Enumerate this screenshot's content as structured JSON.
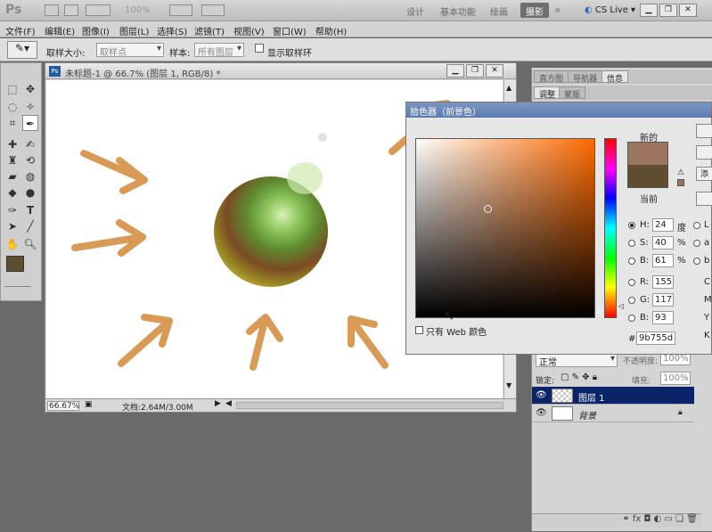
{
  "appbar": {
    "logo": "Ps",
    "zoom": "100%",
    "workspaces": [
      "设计",
      "基本功能",
      "绘画",
      "摄影"
    ],
    "active_workspace": "摄影",
    "more": "»",
    "cslive": "CS Live"
  },
  "menu": [
    "文件(F)",
    "编辑(E)",
    "图像(I)",
    "图层(L)",
    "选择(S)",
    "滤镜(T)",
    "视图(V)",
    "窗口(W)",
    "帮助(H)"
  ],
  "options": {
    "sample_size_label": "取样大小:",
    "sample_size_value": "取样点",
    "sample_label": "样本:",
    "sample_value": "所有图层",
    "show_ring_label": "显示取样环"
  },
  "document": {
    "title": "未标题-1 @ 66.7% (图层 1, RGB/8) *",
    "zoom": "66.67%",
    "doc_size": "文档:2.64M/3.00M"
  },
  "panels": {
    "tabs_top": [
      "直方图",
      "导航器",
      "信息"
    ],
    "tabs_second": [
      "调整",
      "蒙版"
    ],
    "blend_mode": "正常",
    "opacity_label": "不透明度:",
    "opacity_value": "100%",
    "lock_label": "锁定:",
    "fill_label": "填充:",
    "fill_value": "100%",
    "layers": [
      {
        "name": "图层 1",
        "selected": true
      },
      {
        "name": "背景",
        "selected": false,
        "locked": true
      }
    ]
  },
  "picker": {
    "title": "拾色器（前景色）",
    "new_label": "新的",
    "current_label": "当前",
    "new_color": "#9b755d",
    "current_color": "#5e4d2e",
    "h": "24",
    "h_unit": "度",
    "s": "40",
    "s_unit": "%",
    "b": "61",
    "b_unit": "%",
    "r": "155",
    "g": "117",
    "bl": "93",
    "hex": "9b755d",
    "web_only_label": "只有 Web 颜色",
    "right_labels": [
      "L",
      "a",
      "b",
      "C",
      "M",
      "Y",
      "K"
    ],
    "button_add": "添"
  },
  "colors": {
    "foreground": "#5e4d2e",
    "arrow": "#d99a55",
    "selected_layer": "#0a246a"
  }
}
